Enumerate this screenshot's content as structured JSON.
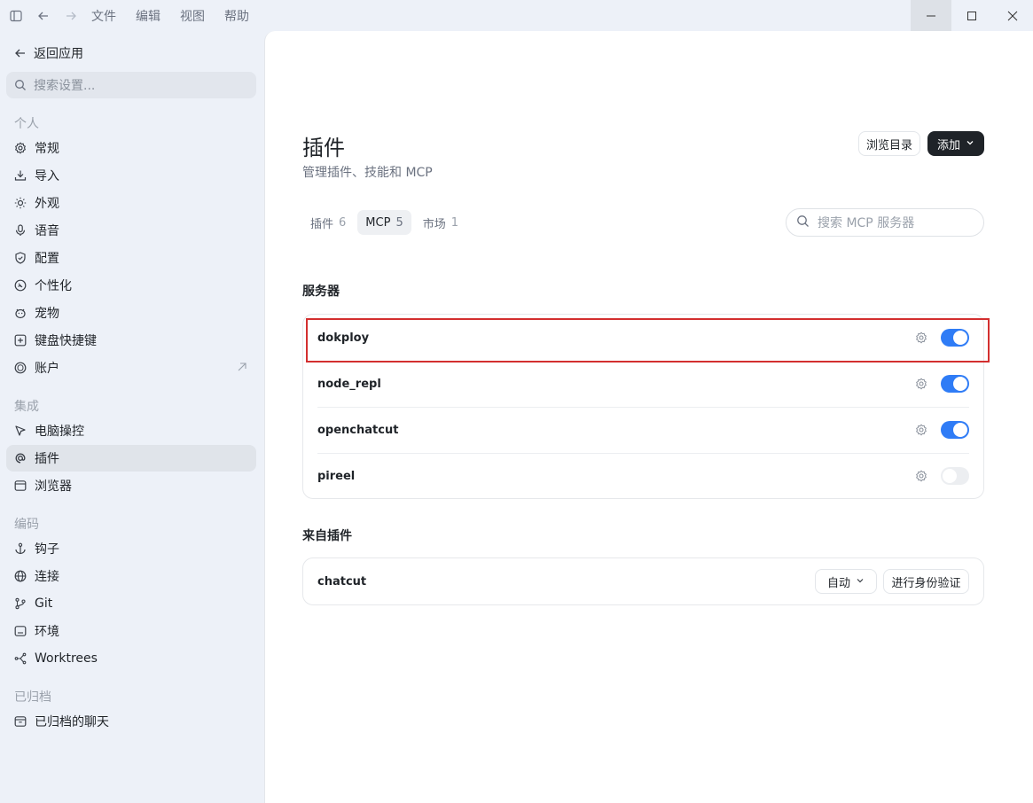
{
  "menu": [
    "文件",
    "编辑",
    "视图",
    "帮助"
  ],
  "sidebar": {
    "back_label": "返回应用",
    "search_placeholder": "搜索设置...",
    "sections": {
      "personal": "个人",
      "integration": "集成",
      "coding": "编码",
      "archived": "已归档"
    },
    "items": [
      {
        "label": "常规",
        "icon": "gear-icon"
      },
      {
        "label": "导入",
        "icon": "download-icon"
      },
      {
        "label": "外观",
        "icon": "sun-icon"
      },
      {
        "label": "语音",
        "icon": "microphone-icon"
      },
      {
        "label": "配置",
        "icon": "shield-icon"
      },
      {
        "label": "个性化",
        "icon": "palette-icon"
      },
      {
        "label": "宠物",
        "icon": "pet-icon"
      },
      {
        "label": "键盘快捷键",
        "icon": "keyboard-icon"
      },
      {
        "label": "账户",
        "icon": "account-icon"
      },
      {
        "label": "电脑操控",
        "icon": "cursor-icon"
      },
      {
        "label": "插件",
        "icon": "at-icon"
      },
      {
        "label": "浏览器",
        "icon": "browser-icon"
      },
      {
        "label": "钩子",
        "icon": "anchor-icon"
      },
      {
        "label": "连接",
        "icon": "globe-icon"
      },
      {
        "label": "Git",
        "icon": "git-icon"
      },
      {
        "label": "环境",
        "icon": "terminal-icon"
      },
      {
        "label": "Worktrees",
        "icon": "worktree-icon"
      },
      {
        "label": "已归档的聊天",
        "icon": "archive-icon"
      }
    ],
    "selected": "插件"
  },
  "page": {
    "title": "插件",
    "subtitle": "管理插件、技能和 MCP",
    "browse_label": "浏览目录",
    "add_label": "添加",
    "tabs": [
      {
        "label": "插件",
        "count": "6"
      },
      {
        "label": "MCP",
        "count": "5"
      },
      {
        "label": "市场",
        "count": "1"
      }
    ],
    "selected_tab": "MCP",
    "search_placeholder": "搜索 MCP 服务器",
    "servers_heading": "服务器",
    "servers": [
      {
        "name": "dokploy",
        "enabled": true
      },
      {
        "name": "node_repl",
        "enabled": true
      },
      {
        "name": "openchatcut",
        "enabled": true
      },
      {
        "name": "pireel",
        "enabled": false
      }
    ],
    "from_plugins_heading": "来自插件",
    "plugin_servers": [
      {
        "name": "chatcut",
        "mode": "自动",
        "auth_label": "进行身份验证"
      }
    ]
  },
  "colors": {
    "toggle_on": "#2f7cf6",
    "highlight": "#d32f2f",
    "dark_button": "#1f2328"
  }
}
